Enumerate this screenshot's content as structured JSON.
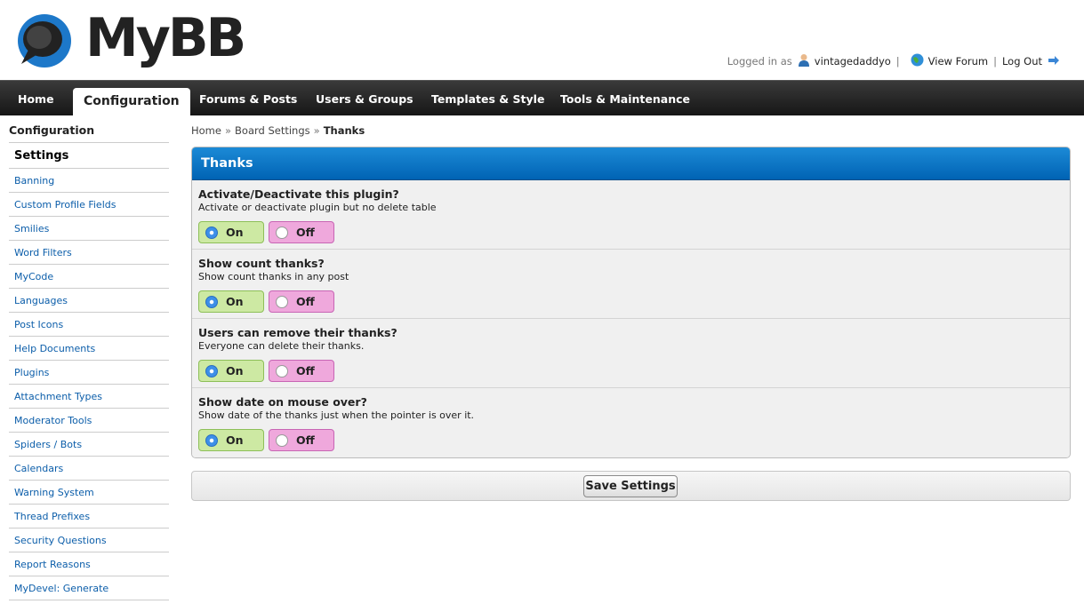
{
  "brand": {
    "name": "MyBB"
  },
  "user_bar": {
    "logged_in_label": "Logged in as",
    "username": "vintagedaddyo",
    "view_forum": "View Forum",
    "log_out": "Log Out"
  },
  "nav": {
    "items": [
      {
        "label": "Home"
      },
      {
        "label": "Configuration"
      },
      {
        "label": "Forums & Posts"
      },
      {
        "label": "Users & Groups"
      },
      {
        "label": "Templates & Style"
      },
      {
        "label": "Tools & Maintenance"
      }
    ],
    "active": "Configuration"
  },
  "sidebar": {
    "title": "Configuration",
    "items": [
      {
        "label": "Settings"
      },
      {
        "label": "Banning"
      },
      {
        "label": "Custom Profile Fields"
      },
      {
        "label": "Smilies"
      },
      {
        "label": "Word Filters"
      },
      {
        "label": "MyCode"
      },
      {
        "label": "Languages"
      },
      {
        "label": "Post Icons"
      },
      {
        "label": "Help Documents"
      },
      {
        "label": "Plugins"
      },
      {
        "label": "Attachment Types"
      },
      {
        "label": "Moderator Tools"
      },
      {
        "label": "Spiders / Bots"
      },
      {
        "label": "Calendars"
      },
      {
        "label": "Warning System"
      },
      {
        "label": "Thread Prefixes"
      },
      {
        "label": "Security Questions"
      },
      {
        "label": "Report Reasons"
      },
      {
        "label": "MyDevel: Generate"
      }
    ]
  },
  "breadcrumb": {
    "home": "Home",
    "section": "Board Settings",
    "current": "Thanks",
    "separator": "»"
  },
  "panel": {
    "title": "Thanks",
    "settings": [
      {
        "title": "Activate/Deactivate this plugin?",
        "desc": "Activate or deactivate plugin but no delete table",
        "on_label": "On",
        "off_label": "Off",
        "value": "On"
      },
      {
        "title": "Show count thanks?",
        "desc": "Show count thanks in any post",
        "on_label": "On",
        "off_label": "Off",
        "value": "On"
      },
      {
        "title": "Users can remove their thanks?",
        "desc": "Everyone can delete their thanks.",
        "on_label": "On",
        "off_label": "Off",
        "value": "On"
      },
      {
        "title": "Show date on mouse over?",
        "desc": "Show date of the thanks just when the pointer is over it.",
        "on_label": "On",
        "off_label": "Off",
        "value": "On"
      }
    ]
  },
  "save_button": "Save Settings",
  "colors": {
    "header_blue": "#0a6fc2",
    "nav_dark": "#222222",
    "link_blue": "#0c5eaa",
    "on_green": "#cde9a3",
    "off_pink": "#efa8dc"
  }
}
